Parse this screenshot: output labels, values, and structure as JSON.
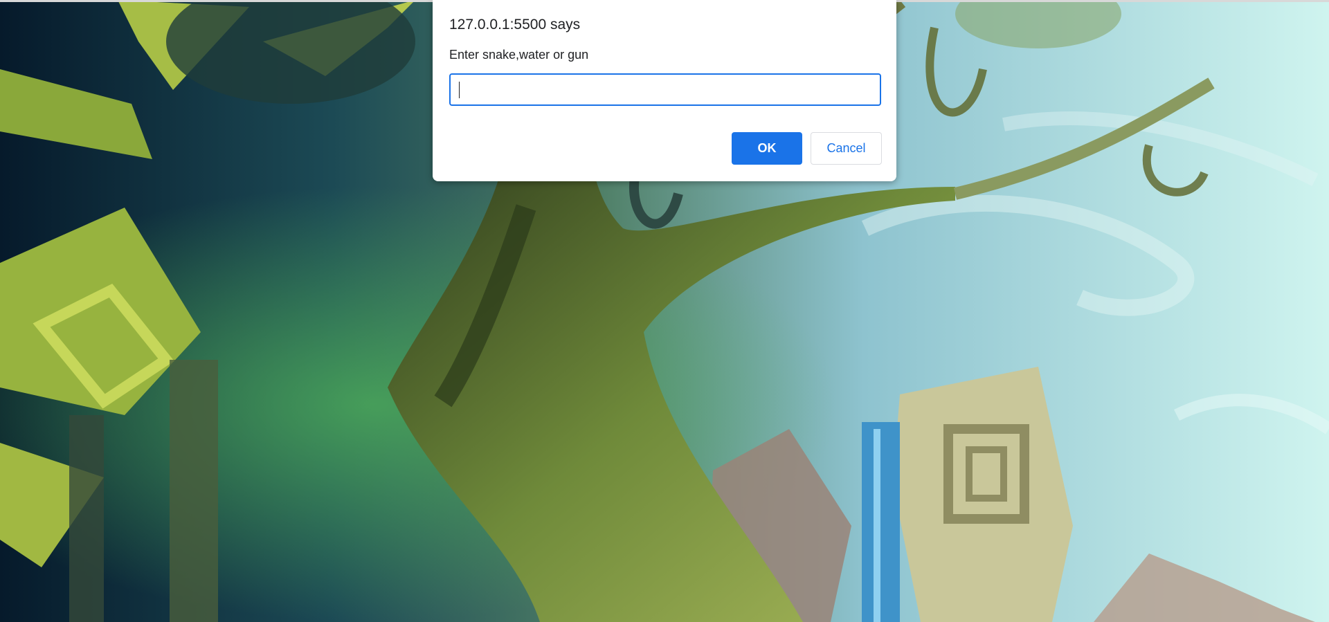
{
  "dialog": {
    "title": "127.0.0.1:5500 says",
    "message": "Enter snake,water or gun",
    "input_value": "",
    "ok_label": "OK",
    "cancel_label": "Cancel"
  },
  "colors": {
    "accent": "#1a73e8",
    "dialog_bg": "#ffffff",
    "text": "#202124"
  }
}
